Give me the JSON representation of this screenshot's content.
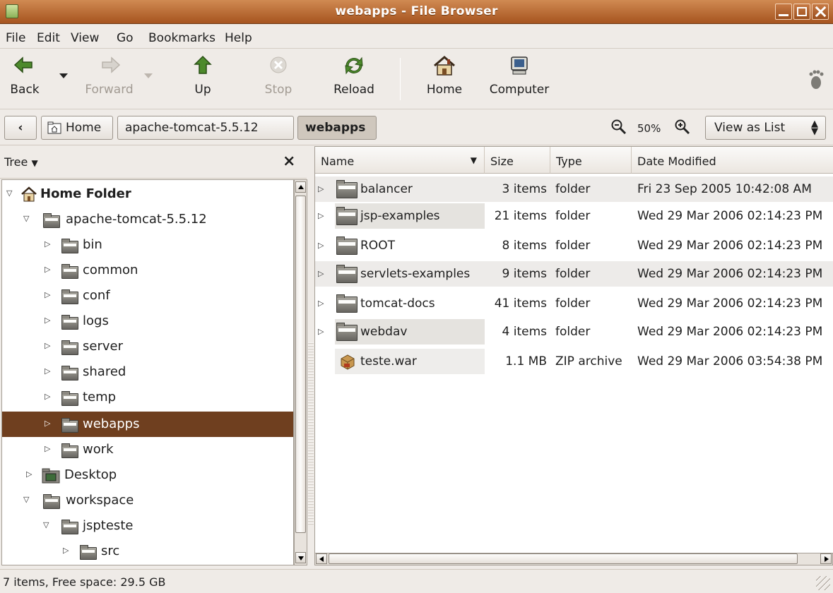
{
  "window": {
    "title": "webapps - File Browser"
  },
  "menu": [
    "File",
    "Edit",
    "View",
    "Go",
    "Bookmarks",
    "Help"
  ],
  "toolbar": {
    "back": "Back",
    "forward": "Forward",
    "up": "Up",
    "stop": "Stop",
    "reload": "Reload",
    "home": "Home",
    "computer": "Computer"
  },
  "location": {
    "crumbs": [
      "Home",
      "apache-tomcat-5.5.12",
      "webapps"
    ],
    "zoom": "50%",
    "view_mode": "View as List"
  },
  "sidebar": {
    "mode": "Tree",
    "items": [
      {
        "label": "Home Folder"
      },
      {
        "label": "apache-tomcat-5.5.12"
      },
      {
        "label": "bin"
      },
      {
        "label": "common"
      },
      {
        "label": "conf"
      },
      {
        "label": "logs"
      },
      {
        "label": "server"
      },
      {
        "label": "shared"
      },
      {
        "label": "temp"
      },
      {
        "label": "webapps"
      },
      {
        "label": "work"
      },
      {
        "label": "Desktop"
      },
      {
        "label": "workspace"
      },
      {
        "label": "jspteste"
      },
      {
        "label": "src"
      }
    ]
  },
  "list": {
    "columns": [
      "Name",
      "Size",
      "Type",
      "Date Modified"
    ],
    "rows": [
      {
        "name": "balancer",
        "size": "3 items",
        "type": "folder",
        "date": "Fri 23 Sep 2005 10:42:08 AM"
      },
      {
        "name": "jsp-examples",
        "size": "21 items",
        "type": "folder",
        "date": "Wed 29 Mar 2006 02:14:23 PM"
      },
      {
        "name": "ROOT",
        "size": "8 items",
        "type": "folder",
        "date": "Wed 29 Mar 2006 02:14:23 PM"
      },
      {
        "name": "servlets-examples",
        "size": "9 items",
        "type": "folder",
        "date": "Wed 29 Mar 2006 02:14:23 PM"
      },
      {
        "name": "tomcat-docs",
        "size": "41 items",
        "type": "folder",
        "date": "Wed 29 Mar 2006 02:14:23 PM"
      },
      {
        "name": "webdav",
        "size": "4 items",
        "type": "folder",
        "date": "Wed 29 Mar 2006 02:14:23 PM"
      },
      {
        "name": "teste.war",
        "size": "1.1 MB",
        "type": "ZIP archive",
        "date": "Wed 29 Mar 2006 03:54:38 PM"
      }
    ]
  },
  "status": {
    "text": "7 items, Free space: 29.5 GB"
  }
}
